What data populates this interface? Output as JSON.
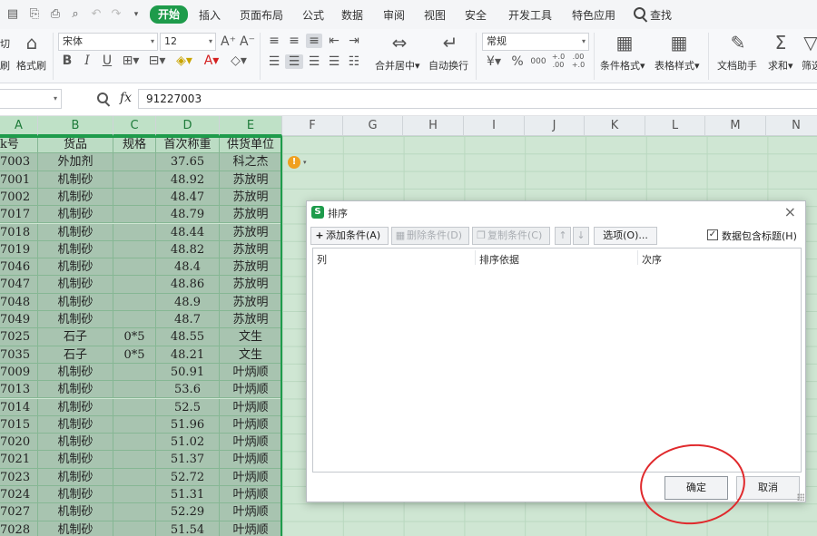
{
  "menubar": {
    "tabs": [
      "开始",
      "插入",
      "页面布局",
      "公式",
      "数据",
      "审阅",
      "视图",
      "安全",
      "开发工具",
      "特色应用"
    ],
    "active_tab": "开始",
    "search_label": "查找"
  },
  "ribbon": {
    "cut_label": "切",
    "brush_left_label": "刷",
    "format_painter_label": "格式刷",
    "font_name": "宋体",
    "font_size": "12",
    "bold": "B",
    "italic": "I",
    "underline": "U",
    "merge_label": "合并居中",
    "wrap_label": "自动换行",
    "number_format": "常规",
    "percent": "%",
    "thousands": "000",
    "inc_decimal": "+.0 .00",
    "dec_decimal": ".00 +.0",
    "conditional_format_label": "条件格式",
    "table_style_label": "表格样式",
    "doc_helper_label": "文档助手",
    "sum_label": "求和",
    "filter_label": "筛选",
    "accent_color": "#1e9b4b"
  },
  "formula_bar": {
    "name_box": "",
    "fx_label": "fx",
    "value": "91227003"
  },
  "sheet": {
    "columns": [
      "A",
      "B",
      "C",
      "D",
      "E",
      "F",
      "G",
      "H",
      "I",
      "J",
      "K",
      "L",
      "M",
      "N"
    ],
    "header_row": [
      "k号",
      "货品",
      "规格",
      "首次称重",
      "供货单位"
    ],
    "rows": [
      [
        "7003",
        "外加剂",
        "",
        "37.65",
        "科之杰"
      ],
      [
        "7001",
        "机制砂",
        "",
        "48.92",
        "苏放明"
      ],
      [
        "7002",
        "机制砂",
        "",
        "48.47",
        "苏放明"
      ],
      [
        "7017",
        "机制砂",
        "",
        "48.79",
        "苏放明"
      ],
      [
        "7018",
        "机制砂",
        "",
        "48.44",
        "苏放明"
      ],
      [
        "7019",
        "机制砂",
        "",
        "48.82",
        "苏放明"
      ],
      [
        "7046",
        "机制砂",
        "",
        "48.4",
        "苏放明"
      ],
      [
        "7047",
        "机制砂",
        "",
        "48.86",
        "苏放明"
      ],
      [
        "7048",
        "机制砂",
        "",
        "48.9",
        "苏放明"
      ],
      [
        "7049",
        "机制砂",
        "",
        "48.7",
        "苏放明"
      ],
      [
        "7025",
        "石子",
        "0*5",
        "48.55",
        "文生"
      ],
      [
        "7035",
        "石子",
        "0*5",
        "48.21",
        "文生"
      ],
      [
        "7009",
        "机制砂",
        "",
        "50.91",
        "叶炳顺"
      ],
      [
        "7013",
        "机制砂",
        "",
        "53.6",
        "叶炳顺"
      ],
      [
        "7014",
        "机制砂",
        "",
        "52.5",
        "叶炳顺"
      ],
      [
        "7015",
        "机制砂",
        "",
        "51.96",
        "叶炳顺"
      ],
      [
        "7020",
        "机制砂",
        "",
        "51.02",
        "叶炳顺"
      ],
      [
        "7021",
        "机制砂",
        "",
        "51.37",
        "叶炳顺"
      ],
      [
        "7023",
        "机制砂",
        "",
        "52.72",
        "叶炳顺"
      ],
      [
        "7024",
        "机制砂",
        "",
        "51.31",
        "叶炳顺"
      ],
      [
        "7027",
        "机制砂",
        "",
        "52.29",
        "叶炳顺"
      ],
      [
        "7028",
        "机制砂",
        "",
        "51.54",
        "叶炳顺"
      ]
    ]
  },
  "dialog": {
    "logo": "S",
    "title": "排序",
    "add_condition": "添加条件(A)",
    "delete_condition": "删除条件(D)",
    "copy_condition": "复制条件(C)",
    "move_up": "↑",
    "move_down": "↓",
    "options": "选项(O)...",
    "has_header_label": "数据包含标题(H)",
    "has_header_checked": true,
    "list_headers": [
      "列",
      "排序依据",
      "次序"
    ],
    "ok": "确定",
    "cancel": "取消"
  }
}
